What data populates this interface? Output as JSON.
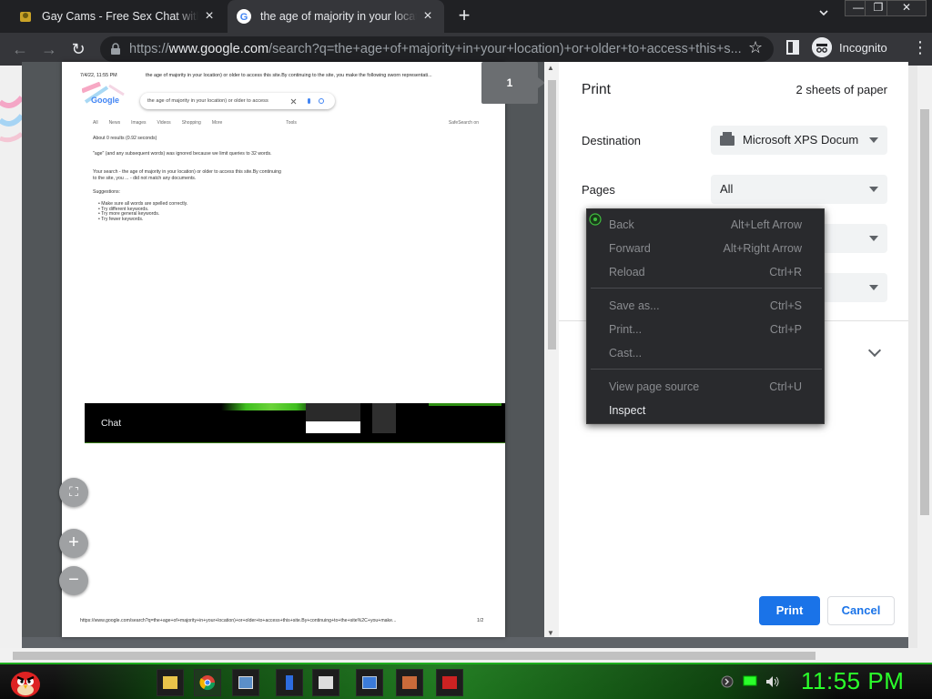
{
  "tabs": [
    {
      "title": "Gay Cams - Free Sex Chat with Se",
      "active": false
    },
    {
      "title": "the age of majority in your locati",
      "active": true
    }
  ],
  "window": {
    "minimize": "—",
    "maximize": "❐",
    "close": "✕"
  },
  "omnibox": {
    "scheme": "https://",
    "host": "www.google.com",
    "path": "/search?q=the+age+of+majority+in+your+location)+or+older+to+access+this+s..."
  },
  "incognito_label": "Incognito",
  "preview": {
    "page_badge": "1",
    "header_date": "7/4/22, 11:55 PM",
    "header_title": "the age of majority in your location) or older to access this site.By continuing to the site, you make the following sworn representati...",
    "search_box_text": "the age of majority in your location) or older to access",
    "google_logo": "Google",
    "search_tabs": [
      "All",
      "News",
      "Images",
      "Videos",
      "Shopping",
      "More",
      "Tools"
    ],
    "safesearch": "SafeSearch on",
    "results_count": "About 0 results (0.92 seconds)",
    "ignored_note": "\"age\" (and any subsequent words) was ignored because we limit queries to 32 words.",
    "no_match_1": "Your search - the age of majority in your location) or older to access this site.By continuing",
    "no_match_2": "to the site, you ... - did not match any documents.",
    "suggestions_label": "Suggestions:",
    "suggestions": [
      "Make sure all words are spelled correctly.",
      "Try different keywords.",
      "Try more general keywords.",
      "Try fewer keywords."
    ],
    "chat_label": "Chat",
    "footer_url": "https://www.google.com/search?q=the+age+of+majority+in+your+location)+or+older+to+access+this+site.By+continuing+to+the+site%2C+you+make...",
    "footer_page": "1/2",
    "zoom_fit": "⛶",
    "zoom_in": "+",
    "zoom_out": "−"
  },
  "print_panel": {
    "title": "Print",
    "sheets": "2 sheets of paper",
    "destination_label": "Destination",
    "destination_value": "Microsoft XPS Docum",
    "pages_label": "Pages",
    "pages_value": "All",
    "print_button": "Print",
    "cancel_button": "Cancel"
  },
  "context_menu": [
    {
      "label": "Back",
      "shortcut": "Alt+Left Arrow",
      "enabled": false
    },
    {
      "label": "Forward",
      "shortcut": "Alt+Right Arrow",
      "enabled": false
    },
    {
      "label": "Reload",
      "shortcut": "Ctrl+R",
      "enabled": false
    },
    {
      "label": "Save as...",
      "shortcut": "Ctrl+S",
      "enabled": false
    },
    {
      "label": "Print...",
      "shortcut": "Ctrl+P",
      "enabled": false
    },
    {
      "label": "Cast...",
      "shortcut": "",
      "enabled": false
    },
    {
      "label": "View page source",
      "shortcut": "Ctrl+U",
      "enabled": false
    },
    {
      "label": "Inspect",
      "shortcut": "",
      "enabled": true
    }
  ],
  "taskbar": {
    "clock": "11:55 PM",
    "apps": [
      "file-manager-icon",
      "chrome-icon",
      "photo-viewer-icon",
      "phone-icon",
      "media-player-icon",
      "browser-window-icon",
      "games-icon",
      "toolbox-icon"
    ]
  },
  "colors": {
    "accent": "#1a73e8",
    "clock_green": "#2bff2b",
    "taskbar_green": "#1fae1f",
    "menu_bg": "#292a2d",
    "chrome_dark": "#202124"
  }
}
